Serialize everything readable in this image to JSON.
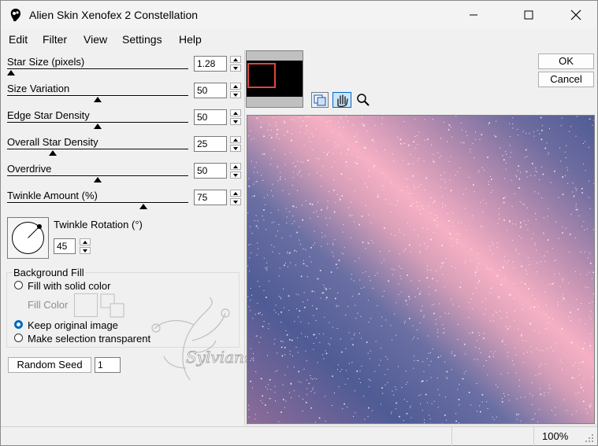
{
  "window": {
    "title": "Alien Skin Xenofex 2 Constellation"
  },
  "menu": [
    "Edit",
    "Filter",
    "View",
    "Settings",
    "Help"
  ],
  "sliders": [
    {
      "label": "Star Size (pixels)",
      "value": "1.28",
      "position": 0.02
    },
    {
      "label": "Size Variation",
      "value": "50",
      "position": 0.5
    },
    {
      "label": "Edge Star Density",
      "value": "50",
      "position": 0.5
    },
    {
      "label": "Overall Star Density",
      "value": "25",
      "position": 0.25
    },
    {
      "label": "Overdrive",
      "value": "50",
      "position": 0.5
    },
    {
      "label": "Twinkle Amount (%)",
      "value": "75",
      "position": 0.75
    }
  ],
  "twinkle_rotation": {
    "label": "Twinkle Rotation (°)",
    "value": "45"
  },
  "background_fill": {
    "title": "Background Fill",
    "options": [
      "Fill with solid color",
      "Keep original image",
      "Make selection transparent"
    ],
    "selected_index": 1,
    "fill_color_label": "Fill Color"
  },
  "random_seed": {
    "label": "Random Seed",
    "value": "1"
  },
  "buttons": {
    "ok": "OK",
    "cancel": "Cancel"
  },
  "status": {
    "zoom": "100%"
  },
  "watermark": "Sylviane",
  "colors": {
    "preview_pink": "#f6b0c4",
    "preview_blue": "#4f5b95",
    "selection_rect": "#e0453d"
  }
}
